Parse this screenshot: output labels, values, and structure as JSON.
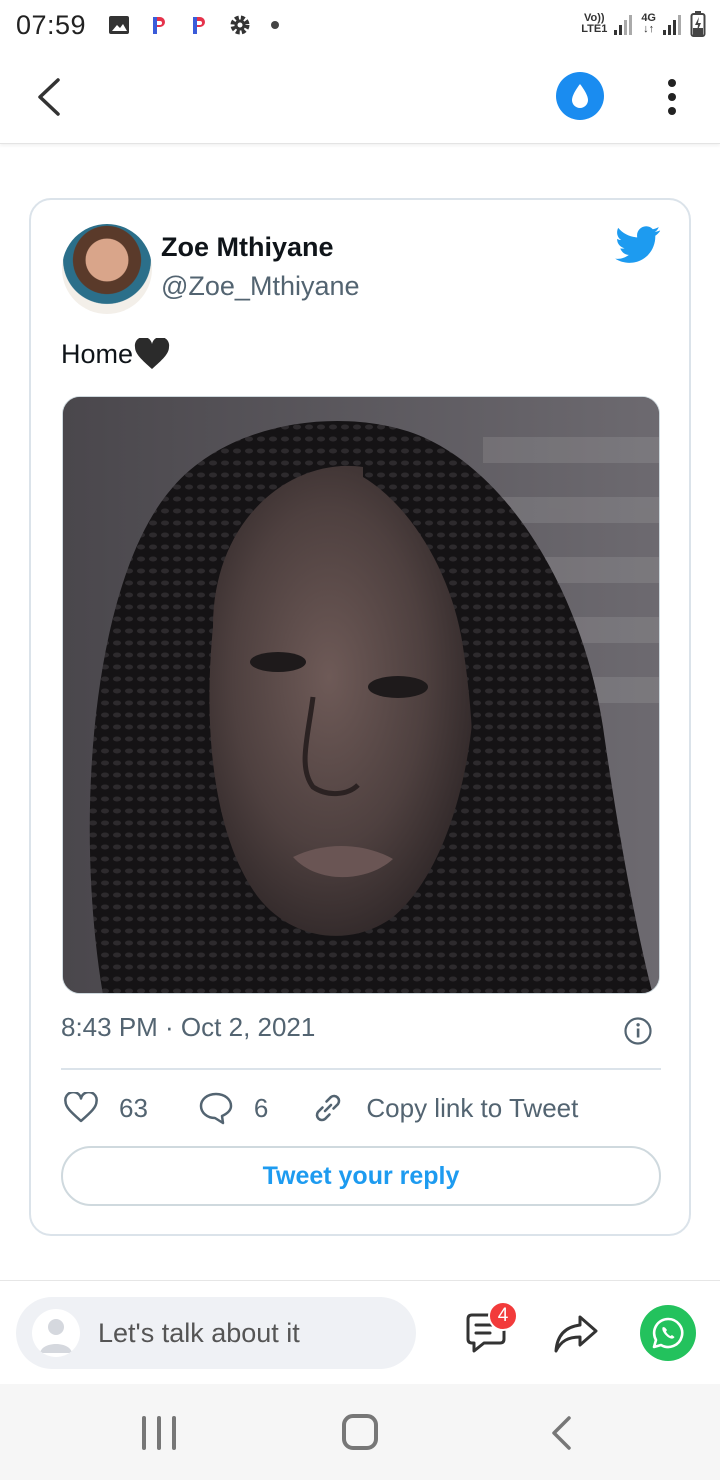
{
  "status_bar": {
    "time": "07:59",
    "sim1_label_top": "Vo))",
    "sim1_label_bottom": "LTE1",
    "sim2_label_top": "4G",
    "sim2_label_bottom": "↓↑"
  },
  "app_bar": {
    "left_icon": "back-arrow-icon",
    "center_icon": "water-drop-icon",
    "right_icon": "more-vert-icon"
  },
  "tweet": {
    "author_name": "Zoe Mthiyane",
    "author_handle": "@Zoe_Mthiyane",
    "text": "Home",
    "timestamp": "8:43 PM · Oct 2, 2021",
    "likes": "63",
    "replies": "6",
    "copy_link_label": "Copy link to Tweet",
    "reply_button_label": "Tweet your reply"
  },
  "comment_bar": {
    "placeholder": "Let's talk about it",
    "comment_count_badge": "4"
  },
  "colors": {
    "twitter_blue": "#1d9bf0",
    "app_accent": "#1a8cf0",
    "whatsapp_green": "#23c25d",
    "badge_red": "#f23b3b"
  }
}
